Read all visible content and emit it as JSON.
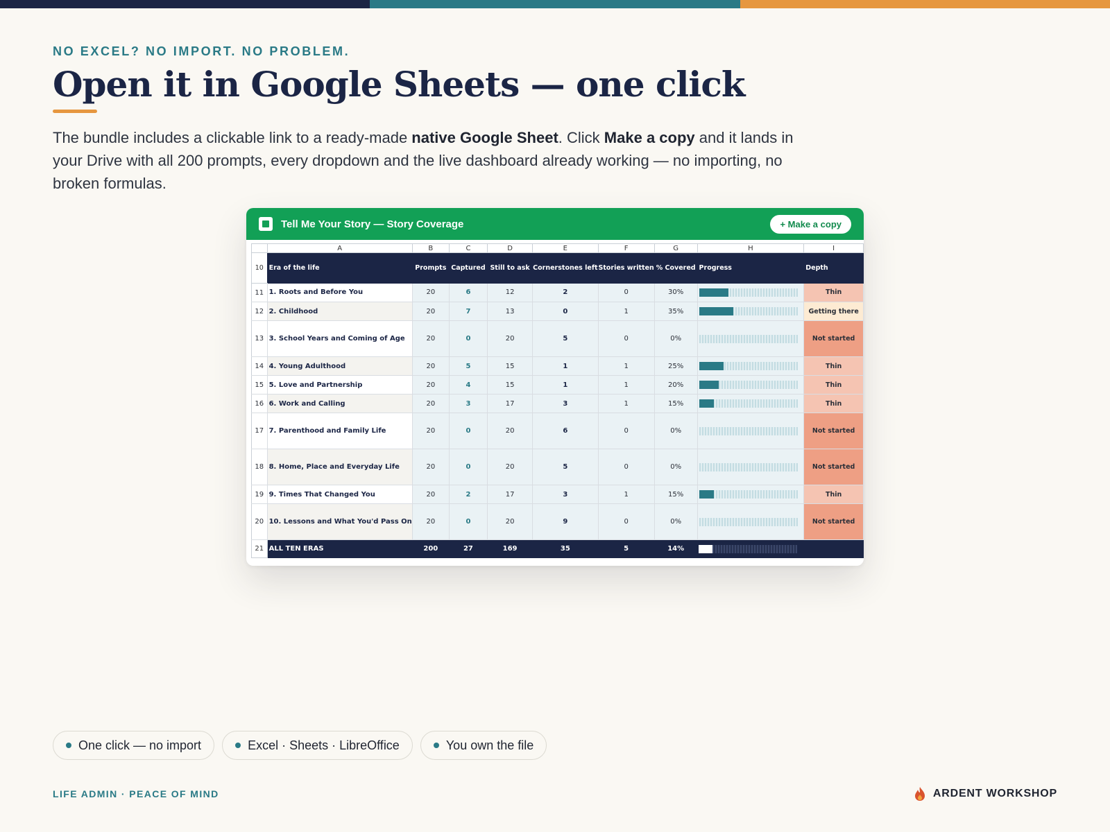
{
  "colors": {
    "top_bar": [
      "#1B2545",
      "#2A7A86",
      "#E6973F"
    ],
    "accent": "#2A7A86",
    "sheets_green": "#12A056"
  },
  "eyebrow": "NO EXCEL? NO IMPORT. NO PROBLEM.",
  "title": "Open it in Google Sheets — one click",
  "lead": {
    "part1": "The bundle includes a clickable link to a ready-made ",
    "bold1": "native Google Sheet",
    "part2": ". Click ",
    "bold2": "Make a copy",
    "part3": " and it lands in your Drive with all 200 prompts, every dropdown and the live dashboard already working — no importing, no broken formulas."
  },
  "sheet": {
    "title": "Tell Me Your Story — Story Coverage",
    "copy_button": "+ Make a copy",
    "column_letters": [
      "A",
      "B",
      "C",
      "D",
      "E",
      "F",
      "G",
      "H",
      "I"
    ],
    "header_row_number": "10",
    "headers": [
      "Era of the life",
      "Prompts",
      "Captured",
      "Still to ask",
      "Cornerstones left",
      "Stories written",
      "% Covered",
      "Progress",
      "Depth"
    ],
    "rows": [
      {
        "n": "11",
        "era": "1. Roots and Before You",
        "prompts": "20",
        "captured": "6",
        "still": "12",
        "corner": "2",
        "written": "0",
        "pct": "30%",
        "progress": 0.3,
        "depth": "Thin",
        "depth_kind": "thin"
      },
      {
        "n": "12",
        "era": "2. Childhood",
        "prompts": "20",
        "captured": "7",
        "still": "13",
        "corner": "0",
        "written": "1",
        "pct": "35%",
        "progress": 0.35,
        "depth": "Getting there",
        "depth_kind": "getting"
      },
      {
        "n": "13",
        "era": "3. School Years and Coming of Age",
        "prompts": "20",
        "captured": "0",
        "still": "20",
        "corner": "5",
        "written": "0",
        "pct": "0%",
        "progress": 0,
        "depth": "Not started",
        "depth_kind": "not"
      },
      {
        "n": "14",
        "era": "4. Young Adulthood",
        "prompts": "20",
        "captured": "5",
        "still": "15",
        "corner": "1",
        "written": "1",
        "pct": "25%",
        "progress": 0.25,
        "depth": "Thin",
        "depth_kind": "thin"
      },
      {
        "n": "15",
        "era": "5. Love and Partnership",
        "prompts": "20",
        "captured": "4",
        "still": "15",
        "corner": "1",
        "written": "1",
        "pct": "20%",
        "progress": 0.2,
        "depth": "Thin",
        "depth_kind": "thin"
      },
      {
        "n": "16",
        "era": "6. Work and Calling",
        "prompts": "20",
        "captured": "3",
        "still": "17",
        "corner": "3",
        "written": "1",
        "pct": "15%",
        "progress": 0.15,
        "depth": "Thin",
        "depth_kind": "thin"
      },
      {
        "n": "17",
        "era": "7. Parenthood and Family Life",
        "prompts": "20",
        "captured": "0",
        "still": "20",
        "corner": "6",
        "written": "0",
        "pct": "0%",
        "progress": 0,
        "depth": "Not started",
        "depth_kind": "not"
      },
      {
        "n": "18",
        "era": "8. Home, Place and Everyday Life",
        "prompts": "20",
        "captured": "0",
        "still": "20",
        "corner": "5",
        "written": "0",
        "pct": "0%",
        "progress": 0,
        "depth": "Not started",
        "depth_kind": "not"
      },
      {
        "n": "19",
        "era": "9. Times That Changed You",
        "prompts": "20",
        "captured": "2",
        "still": "17",
        "corner": "3",
        "written": "1",
        "pct": "15%",
        "progress": 0.15,
        "depth": "Thin",
        "depth_kind": "thin"
      },
      {
        "n": "20",
        "era": "10. Lessons and What You'd Pass On",
        "prompts": "20",
        "captured": "0",
        "still": "20",
        "corner": "9",
        "written": "0",
        "pct": "0%",
        "progress": 0,
        "depth": "Not started",
        "depth_kind": "not"
      }
    ],
    "total": {
      "n": "21",
      "era": "ALL TEN ERAS",
      "prompts": "200",
      "captured": "27",
      "still": "169",
      "corner": "35",
      "written": "5",
      "pct": "14%",
      "progress": 0.14
    }
  },
  "pills": [
    "One click — no import",
    "Excel · Sheets · LibreOffice",
    "You own the file"
  ],
  "footer": {
    "tagline": "LIFE ADMIN · PEACE OF MIND",
    "brand": "ARDENT WORKSHOP",
    "brand_icon": "flame-icon"
  }
}
